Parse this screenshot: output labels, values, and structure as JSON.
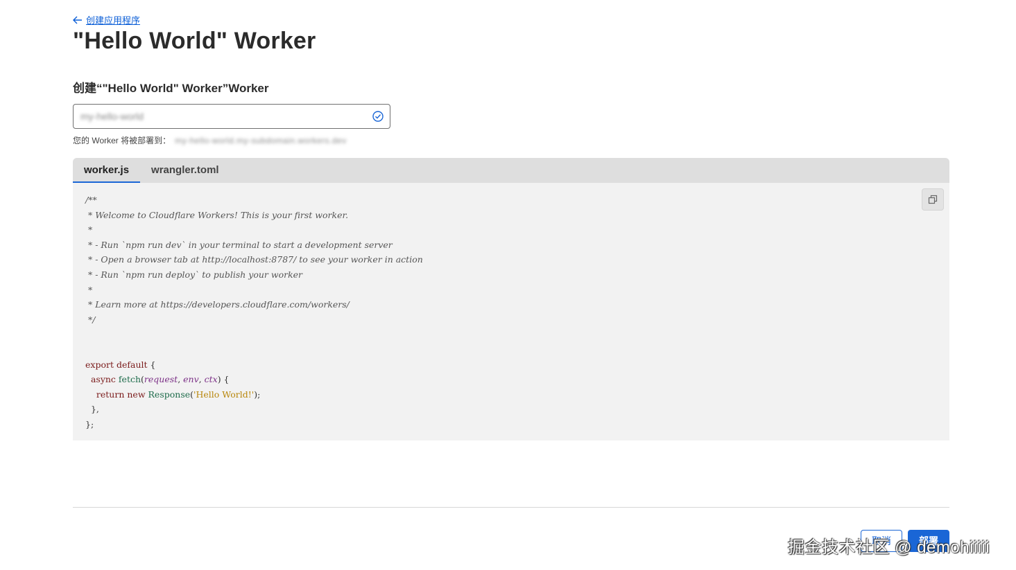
{
  "nav": {
    "back_label": "创建应用程序"
  },
  "page": {
    "title": "\"Hello World\" Worker"
  },
  "form": {
    "section_title": "创建“\"Hello World\" Worker”Worker",
    "name_value": "my-hello-world",
    "deploy_hint_label": "您的 Worker 将被部署到：",
    "deploy_url": "my-hello-world.my-subdomain.workers.dev"
  },
  "editor": {
    "tabs": [
      {
        "label": "worker.js",
        "active": true
      },
      {
        "label": "wrangler.toml",
        "active": false
      }
    ],
    "code": {
      "comment_lines": [
        "/**",
        " * Welcome to Cloudflare Workers! This is your first worker.",
        " *",
        " * - Run `npm run dev` in your terminal to start a development server",
        " * - Open a browser tab at http://localhost:8787/ to see your worker in action",
        " * - Run `npm run deploy` to publish your worker",
        " *",
        " * Learn more at https://developers.cloudflare.com/workers/",
        " */"
      ],
      "kw_export": "export",
      "kw_default": "default",
      "brace_open": " {",
      "kw_async": "async",
      "fn_fetch": "fetch",
      "param_request": "request",
      "param_env": "env",
      "param_ctx": "ctx",
      "kw_return": "return",
      "kw_new": "new",
      "fn_response": "Response",
      "str_hello": "'Hello World!'",
      "close_fn": "},",
      "close_obj": "};"
    }
  },
  "footer": {
    "cancel_label": "取消",
    "deploy_label": "部署",
    "watermark": "掘金技术社区 @ demohiiiii"
  },
  "colors": {
    "accent": "#1a66d6",
    "tab_bar": "#dedede",
    "editor_bg": "#f2f2f2"
  },
  "icons": {
    "back": "arrow-left-icon",
    "valid": "check-circle-icon",
    "copy": "copy-icon"
  }
}
